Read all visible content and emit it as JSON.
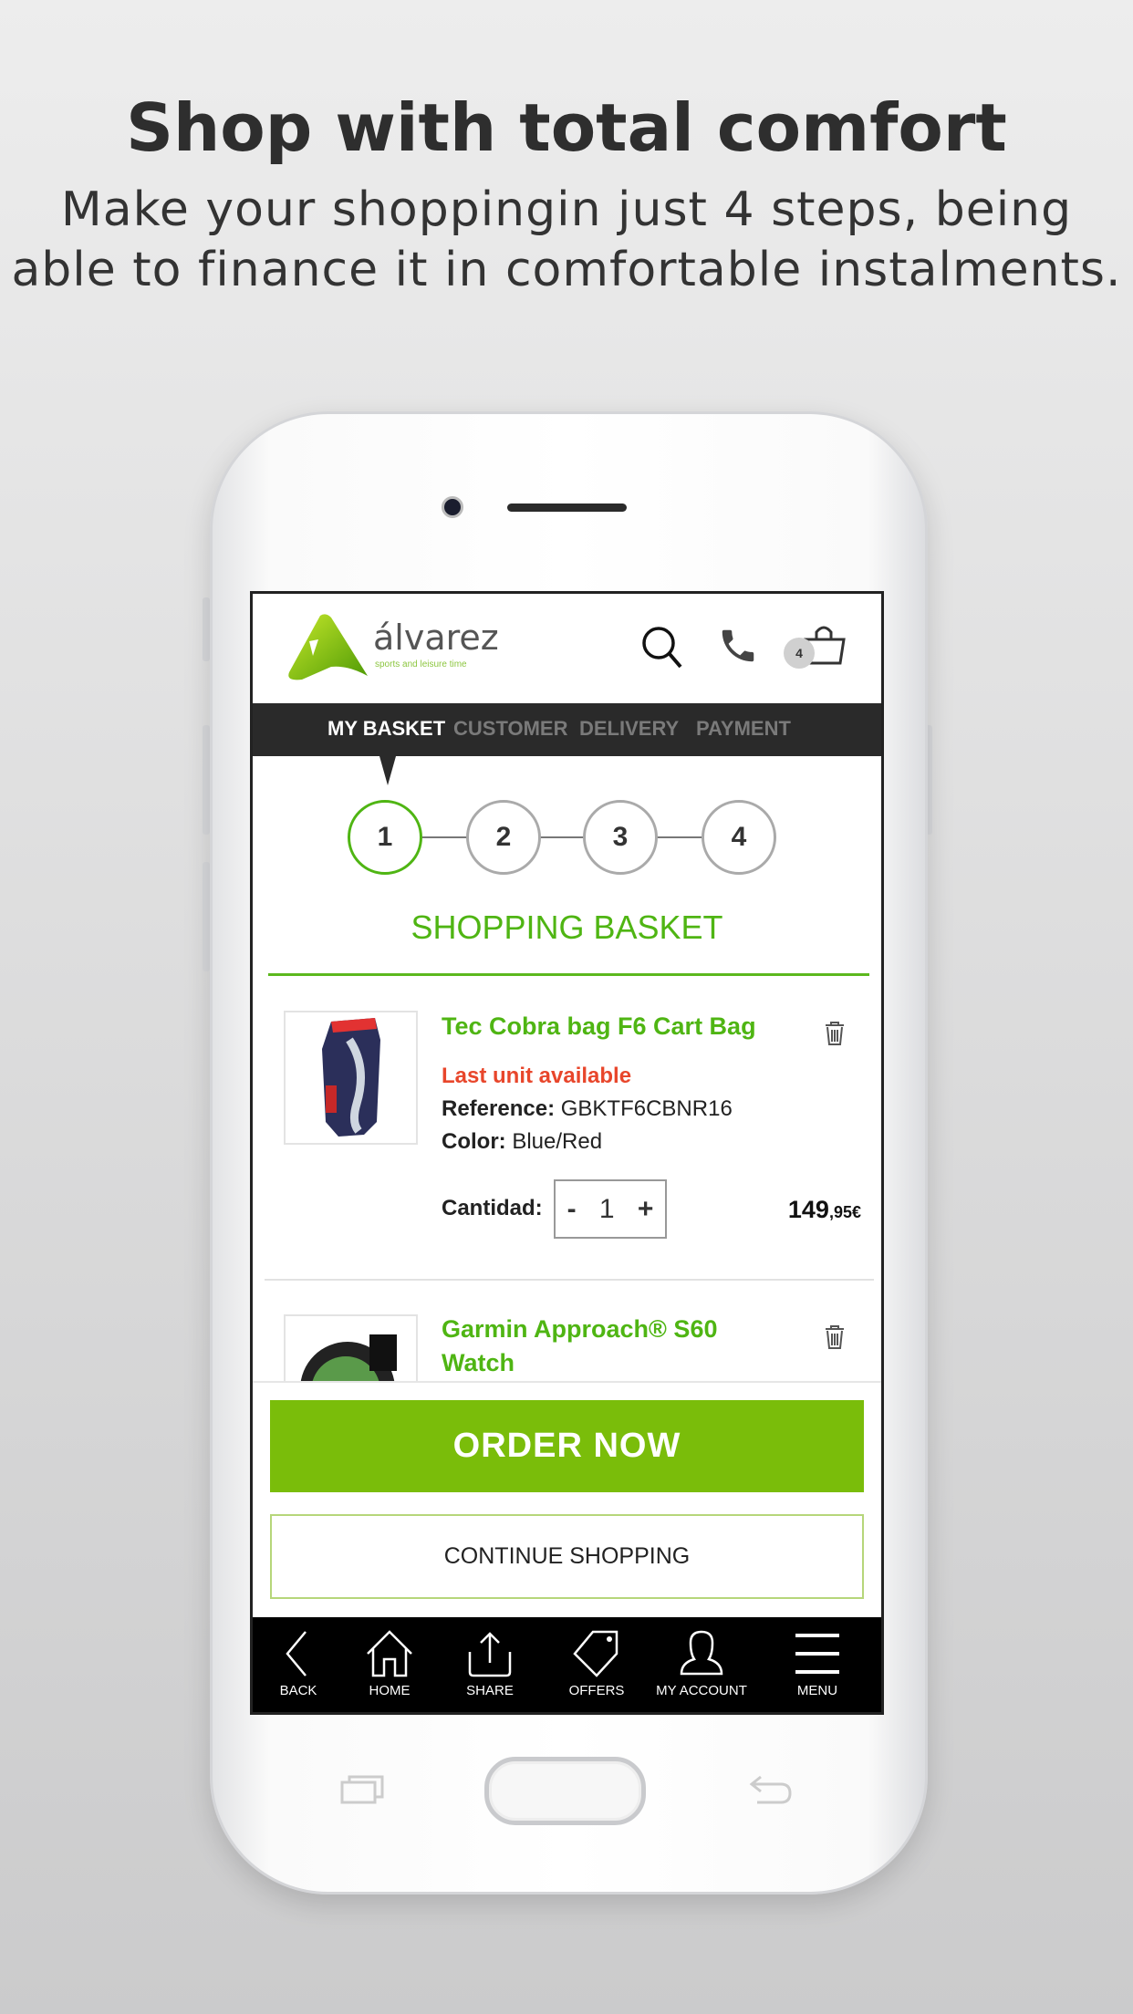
{
  "promo": {
    "title": "Shop with total comfort",
    "subtitle_line1": "Make your shoppingin just 4 steps, being",
    "subtitle_line2": "able to finance it in comfortable instalments."
  },
  "header": {
    "brand": "álvarez",
    "tagline": "sports and leisure time",
    "cart_count": "4"
  },
  "checkout_tabs": [
    {
      "label": "MY BASKET",
      "active": true
    },
    {
      "label": "CUSTOMER",
      "active": false
    },
    {
      "label": "DELIVERY",
      "active": false
    },
    {
      "label": "PAYMENT",
      "active": false
    }
  ],
  "steps": [
    "1",
    "2",
    "3",
    "4"
  ],
  "current_step": 1,
  "section_title": "SHOPPING BASKET",
  "products": [
    {
      "name": "Tec Cobra bag F6 Cart Bag",
      "stock": "Last unit available",
      "reference_label": "Reference:",
      "reference": "GBKTF6CBNR16",
      "color_label": "Color:",
      "color": "Blue/Red",
      "qty_label": "Cantidad:",
      "qty": "1",
      "price_int": "149",
      "price_dec": ",95€"
    },
    {
      "name_line1": "Garmin Approach® S60",
      "name_line2": "Watch"
    }
  ],
  "actions": {
    "order": "ORDER NOW",
    "continue": "CONTINUE SHOPPING"
  },
  "bottom_nav": [
    {
      "label": "BACK",
      "icon": "chevron-left"
    },
    {
      "label": "HOME",
      "icon": "house"
    },
    {
      "label": "SHARE",
      "icon": "share"
    },
    {
      "label": "OFFERS",
      "icon": "tag"
    },
    {
      "label": "MY ACCOUNT",
      "icon": "user"
    },
    {
      "label": "MENU",
      "icon": "hamburger"
    }
  ],
  "colors": {
    "accent": "#4fb513",
    "button": "#7abd0a",
    "warning": "#e8462b",
    "navbar": "#2a2a2a"
  }
}
